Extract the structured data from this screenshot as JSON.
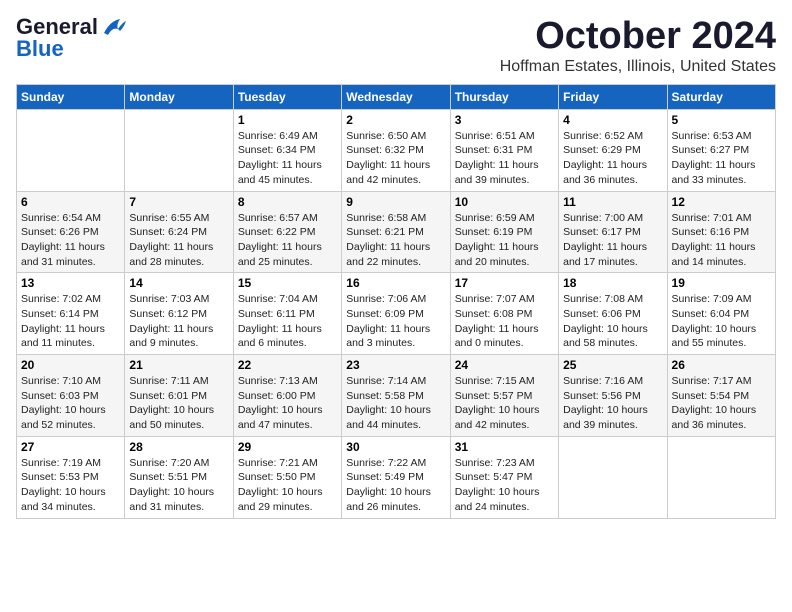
{
  "logo": {
    "general": "General",
    "blue": "Blue"
  },
  "header": {
    "month": "October 2024",
    "location": "Hoffman Estates, Illinois, United States"
  },
  "weekdays": [
    "Sunday",
    "Monday",
    "Tuesday",
    "Wednesday",
    "Thursday",
    "Friday",
    "Saturday"
  ],
  "weeks": [
    [
      {
        "day": "",
        "info": ""
      },
      {
        "day": "",
        "info": ""
      },
      {
        "day": "1",
        "info": "Sunrise: 6:49 AM\nSunset: 6:34 PM\nDaylight: 11 hours and 45 minutes."
      },
      {
        "day": "2",
        "info": "Sunrise: 6:50 AM\nSunset: 6:32 PM\nDaylight: 11 hours and 42 minutes."
      },
      {
        "day": "3",
        "info": "Sunrise: 6:51 AM\nSunset: 6:31 PM\nDaylight: 11 hours and 39 minutes."
      },
      {
        "day": "4",
        "info": "Sunrise: 6:52 AM\nSunset: 6:29 PM\nDaylight: 11 hours and 36 minutes."
      },
      {
        "day": "5",
        "info": "Sunrise: 6:53 AM\nSunset: 6:27 PM\nDaylight: 11 hours and 33 minutes."
      }
    ],
    [
      {
        "day": "6",
        "info": "Sunrise: 6:54 AM\nSunset: 6:26 PM\nDaylight: 11 hours and 31 minutes."
      },
      {
        "day": "7",
        "info": "Sunrise: 6:55 AM\nSunset: 6:24 PM\nDaylight: 11 hours and 28 minutes."
      },
      {
        "day": "8",
        "info": "Sunrise: 6:57 AM\nSunset: 6:22 PM\nDaylight: 11 hours and 25 minutes."
      },
      {
        "day": "9",
        "info": "Sunrise: 6:58 AM\nSunset: 6:21 PM\nDaylight: 11 hours and 22 minutes."
      },
      {
        "day": "10",
        "info": "Sunrise: 6:59 AM\nSunset: 6:19 PM\nDaylight: 11 hours and 20 minutes."
      },
      {
        "day": "11",
        "info": "Sunrise: 7:00 AM\nSunset: 6:17 PM\nDaylight: 11 hours and 17 minutes."
      },
      {
        "day": "12",
        "info": "Sunrise: 7:01 AM\nSunset: 6:16 PM\nDaylight: 11 hours and 14 minutes."
      }
    ],
    [
      {
        "day": "13",
        "info": "Sunrise: 7:02 AM\nSunset: 6:14 PM\nDaylight: 11 hours and 11 minutes."
      },
      {
        "day": "14",
        "info": "Sunrise: 7:03 AM\nSunset: 6:12 PM\nDaylight: 11 hours and 9 minutes."
      },
      {
        "day": "15",
        "info": "Sunrise: 7:04 AM\nSunset: 6:11 PM\nDaylight: 11 hours and 6 minutes."
      },
      {
        "day": "16",
        "info": "Sunrise: 7:06 AM\nSunset: 6:09 PM\nDaylight: 11 hours and 3 minutes."
      },
      {
        "day": "17",
        "info": "Sunrise: 7:07 AM\nSunset: 6:08 PM\nDaylight: 11 hours and 0 minutes."
      },
      {
        "day": "18",
        "info": "Sunrise: 7:08 AM\nSunset: 6:06 PM\nDaylight: 10 hours and 58 minutes."
      },
      {
        "day": "19",
        "info": "Sunrise: 7:09 AM\nSunset: 6:04 PM\nDaylight: 10 hours and 55 minutes."
      }
    ],
    [
      {
        "day": "20",
        "info": "Sunrise: 7:10 AM\nSunset: 6:03 PM\nDaylight: 10 hours and 52 minutes."
      },
      {
        "day": "21",
        "info": "Sunrise: 7:11 AM\nSunset: 6:01 PM\nDaylight: 10 hours and 50 minutes."
      },
      {
        "day": "22",
        "info": "Sunrise: 7:13 AM\nSunset: 6:00 PM\nDaylight: 10 hours and 47 minutes."
      },
      {
        "day": "23",
        "info": "Sunrise: 7:14 AM\nSunset: 5:58 PM\nDaylight: 10 hours and 44 minutes."
      },
      {
        "day": "24",
        "info": "Sunrise: 7:15 AM\nSunset: 5:57 PM\nDaylight: 10 hours and 42 minutes."
      },
      {
        "day": "25",
        "info": "Sunrise: 7:16 AM\nSunset: 5:56 PM\nDaylight: 10 hours and 39 minutes."
      },
      {
        "day": "26",
        "info": "Sunrise: 7:17 AM\nSunset: 5:54 PM\nDaylight: 10 hours and 36 minutes."
      }
    ],
    [
      {
        "day": "27",
        "info": "Sunrise: 7:19 AM\nSunset: 5:53 PM\nDaylight: 10 hours and 34 minutes."
      },
      {
        "day": "28",
        "info": "Sunrise: 7:20 AM\nSunset: 5:51 PM\nDaylight: 10 hours and 31 minutes."
      },
      {
        "day": "29",
        "info": "Sunrise: 7:21 AM\nSunset: 5:50 PM\nDaylight: 10 hours and 29 minutes."
      },
      {
        "day": "30",
        "info": "Sunrise: 7:22 AM\nSunset: 5:49 PM\nDaylight: 10 hours and 26 minutes."
      },
      {
        "day": "31",
        "info": "Sunrise: 7:23 AM\nSunset: 5:47 PM\nDaylight: 10 hours and 24 minutes."
      },
      {
        "day": "",
        "info": ""
      },
      {
        "day": "",
        "info": ""
      }
    ]
  ]
}
